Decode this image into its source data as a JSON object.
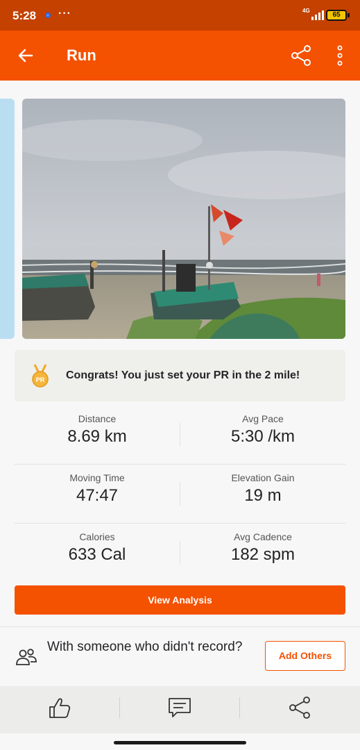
{
  "status_bar": {
    "time": "5:28",
    "more": "···",
    "network": "4G",
    "battery": "65"
  },
  "app_bar": {
    "title": "Run"
  },
  "pr_banner": {
    "text": "Congrats! You just set your PR in the 2 mile!",
    "badge": "PR"
  },
  "stats": [
    {
      "label": "Distance",
      "value": "8.69 km"
    },
    {
      "label": "Avg Pace",
      "value": "5:30 /km"
    },
    {
      "label": "Moving Time",
      "value": "47:47"
    },
    {
      "label": "Elevation Gain",
      "value": "19 m"
    },
    {
      "label": "Calories",
      "value": "633 Cal"
    },
    {
      "label": "Avg Cadence",
      "value": "182 spm"
    }
  ],
  "view_analysis": "View Analysis",
  "with_others": {
    "text": "With someone who didn't record?",
    "button": "Add Others"
  },
  "colors": {
    "brand": "#f45100",
    "status_bar": "#c44100",
    "side_card": "#b9def2"
  },
  "icons": [
    "back-arrow-icon",
    "share-icon",
    "kebab-menu-icon",
    "medal-icon",
    "people-icon",
    "thumbs-up-icon",
    "comment-icon"
  ]
}
